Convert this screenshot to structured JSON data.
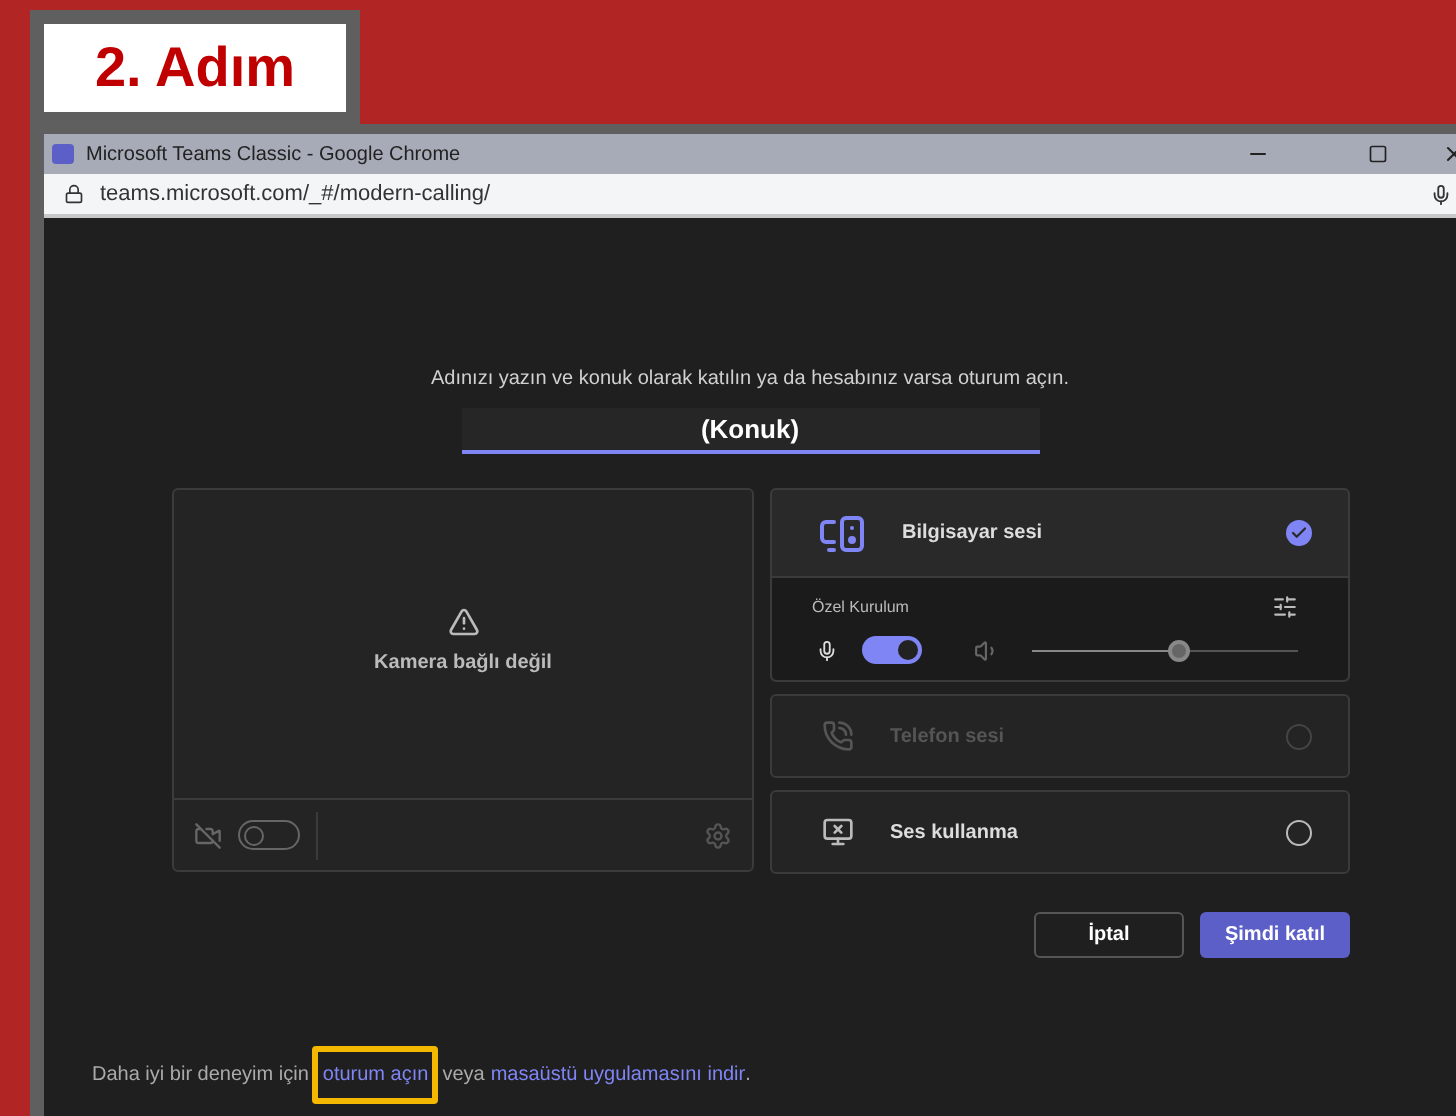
{
  "step_label": "2. Adım",
  "window": {
    "title": "Microsoft Teams Classic - Google Chrome",
    "url": "teams.microsoft.com/_#/modern-calling/"
  },
  "prompt": "Adınızı yazın ve konuk olarak katılın ya da hesabınız varsa oturum açın.",
  "name_field": {
    "value": "(Konuk)"
  },
  "camera": {
    "message": "Kamera bağlı değil",
    "on": false
  },
  "audio_options": [
    {
      "kind": "computer",
      "label": "Bilgisayar sesi",
      "selected": true,
      "disabled": false,
      "setup_label": "Özel Kurulum",
      "mic_on": true,
      "level": 0.55
    },
    {
      "kind": "phone",
      "label": "Telefon sesi",
      "selected": false,
      "disabled": true
    },
    {
      "kind": "none",
      "label": "Ses kullanma",
      "selected": false,
      "disabled": false
    }
  ],
  "buttons": [
    {
      "label": "İptal",
      "kind": "secondary"
    },
    {
      "label": "Şimdi katıl",
      "kind": "primary"
    }
  ],
  "footer": {
    "before": "Daha iyi bir deneyim için",
    "link1": "oturum açın",
    "middle": "veya",
    "link2": "masaüstü uygulamasını indir",
    "after": "."
  }
}
